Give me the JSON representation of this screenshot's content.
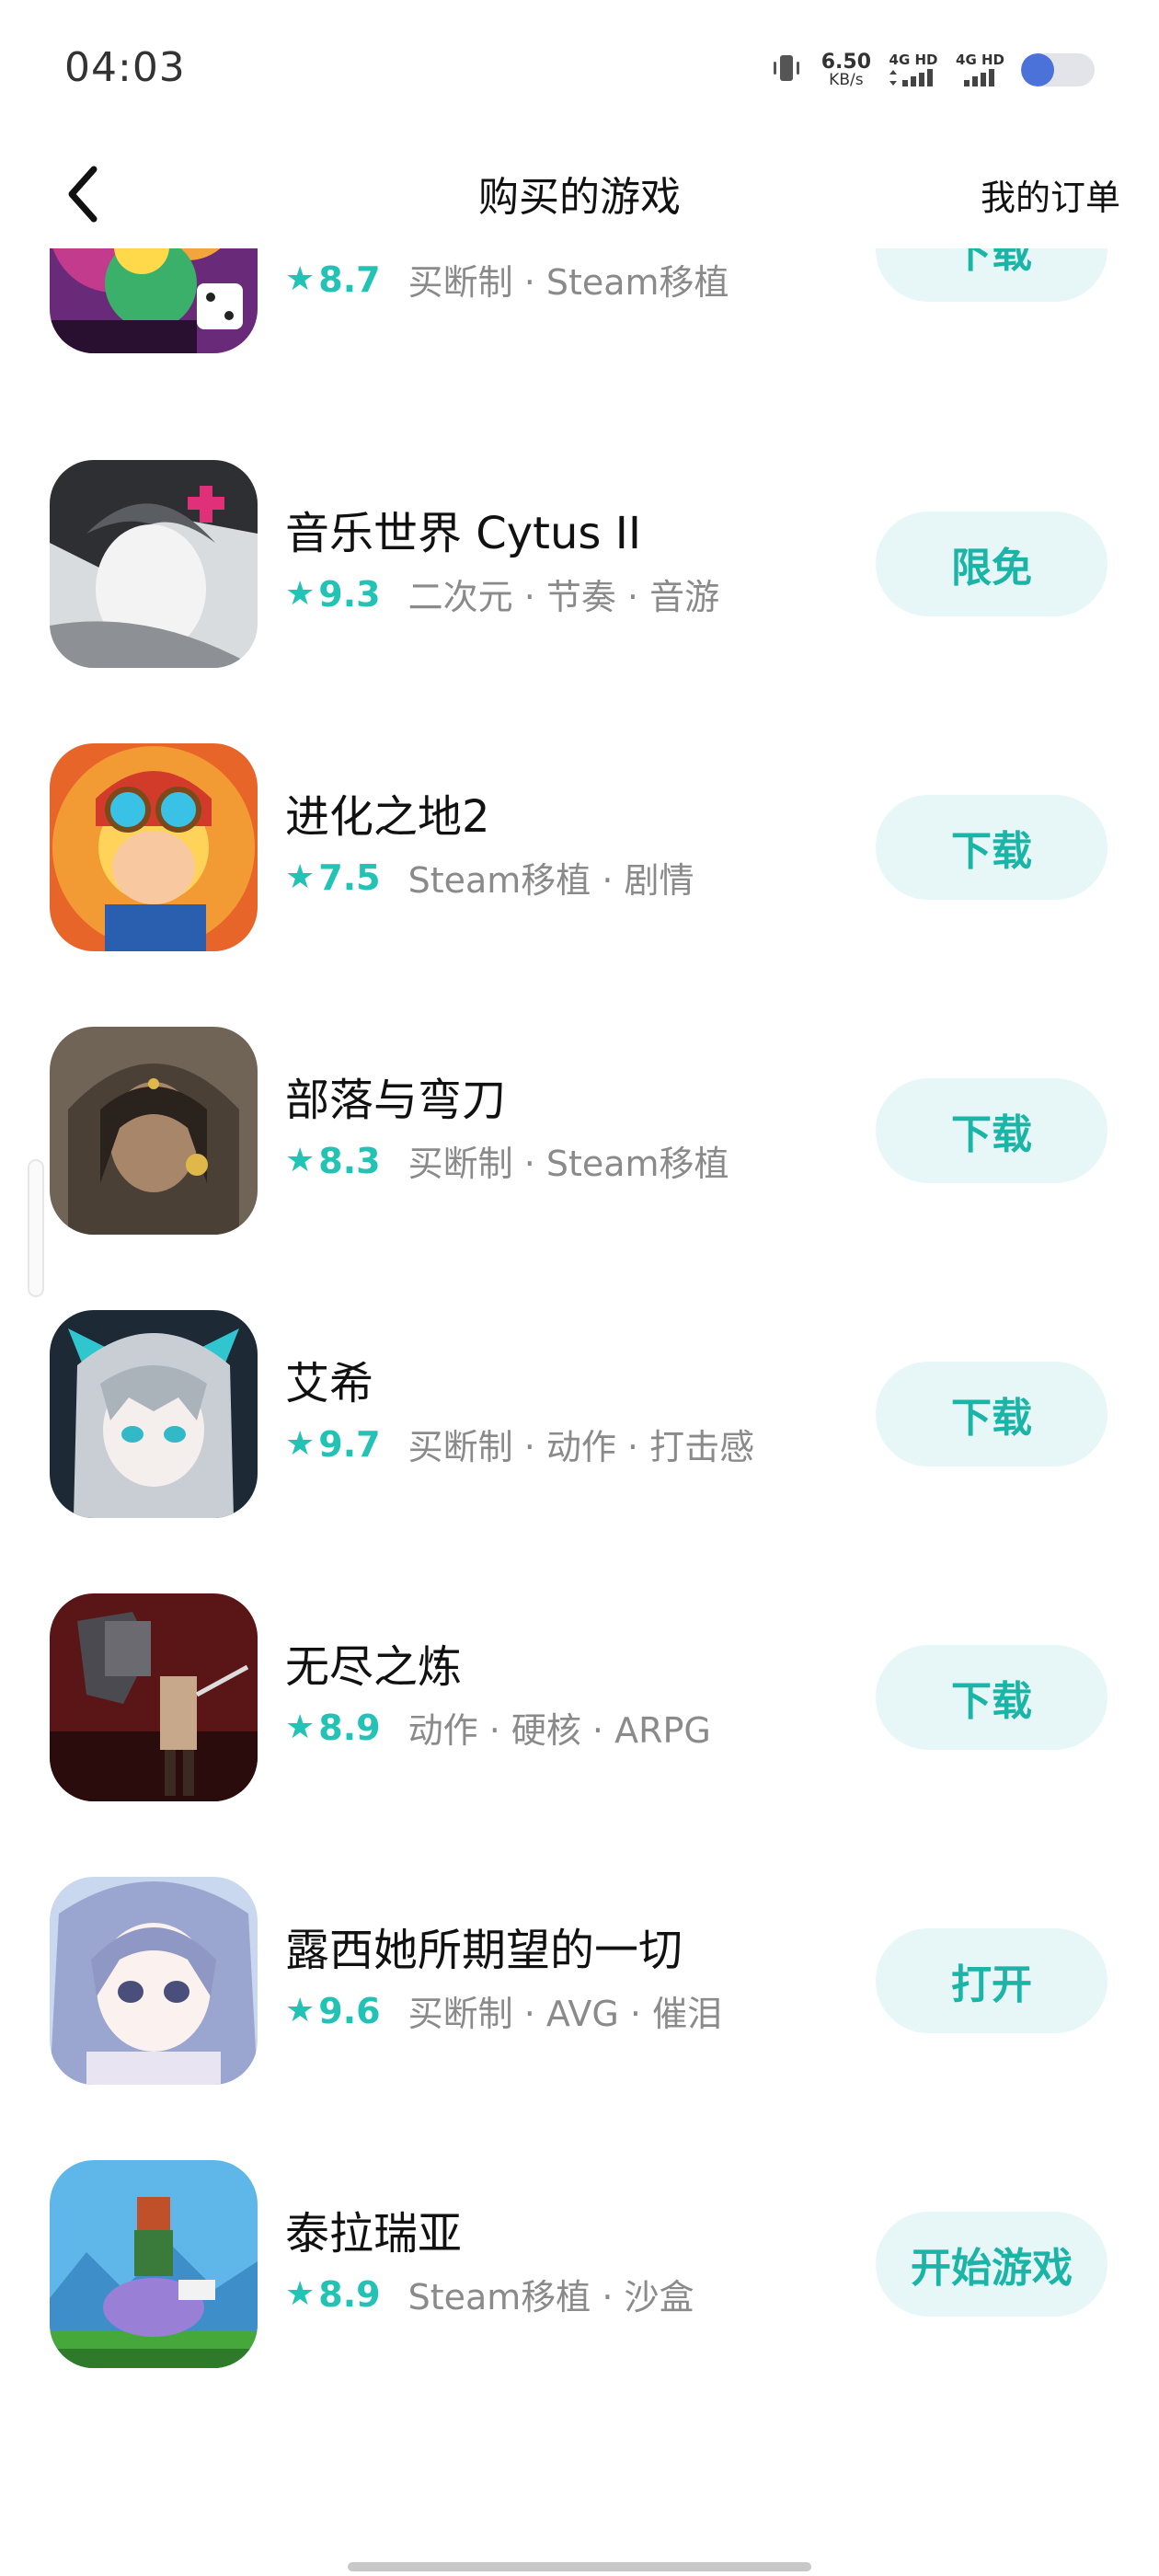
{
  "status_bar": {
    "time": "04:03",
    "net_speed_value": "6.50",
    "net_speed_unit": "KB/s",
    "sim1_label": "4G HD",
    "sim2_label": "4G HD",
    "battery_level": 0.45,
    "battery_color": "#4a72d8"
  },
  "nav": {
    "title": "购买的游戏",
    "orders_label": "我的订单",
    "back_icon": "chevron-left-icon"
  },
  "colors": {
    "accent": "#22c2b4",
    "button_bg": "#e7f7f7",
    "button_text": "#1bb5a8"
  },
  "games": [
    {
      "name": "",
      "rating": "8.7",
      "tags": "买断制 · Steam移植",
      "action": "下载"
    },
    {
      "name": "音乐世界 Cytus II",
      "rating": "9.3",
      "tags": "二次元 · 节奏 · 音游",
      "action": "限免"
    },
    {
      "name": "进化之地2",
      "rating": "7.5",
      "tags": "Steam移植 · 剧情",
      "action": "下载"
    },
    {
      "name": "部落与弯刀",
      "rating": "8.3",
      "tags": "买断制 · Steam移植",
      "action": "下载"
    },
    {
      "name": "艾希",
      "rating": "9.7",
      "tags": "买断制 · 动作 · 打击感",
      "action": "下载"
    },
    {
      "name": "无尽之炼",
      "rating": "8.9",
      "tags": "动作 · 硬核 · ARPG",
      "action": "下载"
    },
    {
      "name": "露西她所期望的一切",
      "rating": "9.6",
      "tags": "买断制 · AVG · 催泪",
      "action": "打开"
    },
    {
      "name": "泰拉瑞亚",
      "rating": "8.9",
      "tags": "Steam移植 · 沙盒",
      "action": "开始游戏"
    }
  ]
}
